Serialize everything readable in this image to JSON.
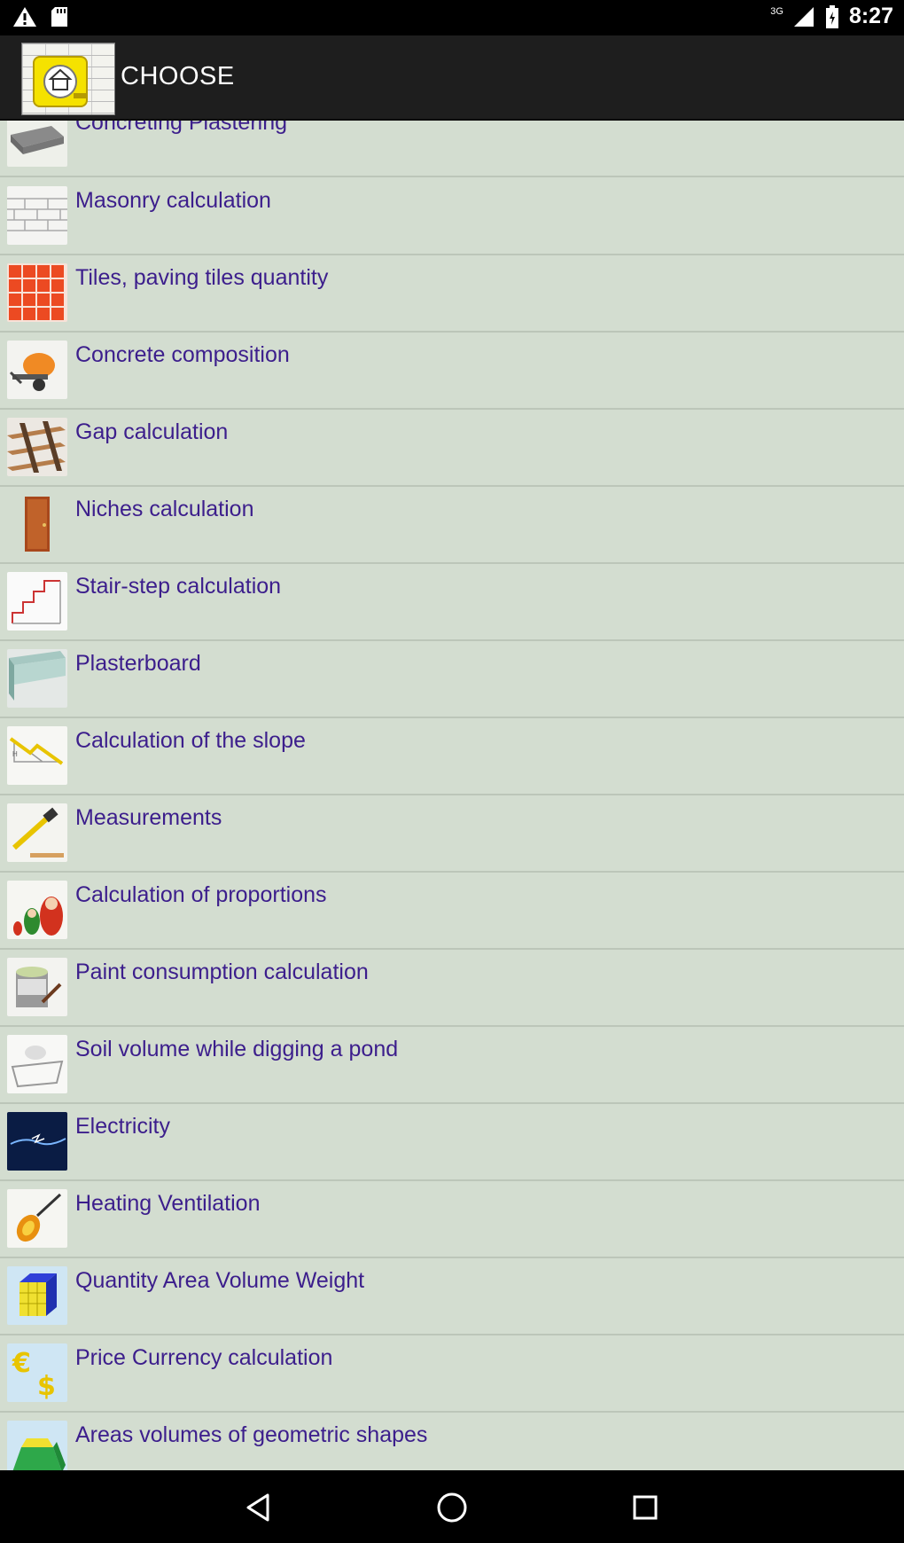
{
  "status_bar": {
    "time": "8:27",
    "network": "3G",
    "left_icons": [
      "warning-icon",
      "sd-card-icon"
    ],
    "right_icons": [
      "signal-icon",
      "battery-icon"
    ]
  },
  "app_bar": {
    "title": "CHOOSE",
    "logo_icon": "house-tape-measure-icon"
  },
  "list": {
    "items": [
      {
        "label": "Concreting Plastering",
        "icon": "concrete-slab-icon"
      },
      {
        "label": "Masonry calculation",
        "icon": "brick-wall-icon"
      },
      {
        "label": "Tiles, paving tiles quantity",
        "icon": "tiles-icon"
      },
      {
        "label": "Concrete composition",
        "icon": "concrete-mixer-icon"
      },
      {
        "label": "Gap calculation",
        "icon": "wood-frame-icon"
      },
      {
        "label": "Niches calculation",
        "icon": "door-icon"
      },
      {
        "label": "Stair-step calculation",
        "icon": "stairs-diagram-icon"
      },
      {
        "label": "Plasterboard",
        "icon": "plasterboard-icon"
      },
      {
        "label": "Calculation of the slope",
        "icon": "slope-icon"
      },
      {
        "label": "Measurements",
        "icon": "measuring-tool-icon"
      },
      {
        "label": "Calculation of proportions",
        "icon": "nesting-dolls-icon"
      },
      {
        "label": "Paint consumption calculation",
        "icon": "paint-bucket-icon"
      },
      {
        "label": "Soil volume while digging a pond",
        "icon": "pond-icon"
      },
      {
        "label": "Electricity",
        "icon": "electricity-icon"
      },
      {
        "label": "Heating Ventilation",
        "icon": "flame-icon"
      },
      {
        "label": "Quantity Area Volume Weight",
        "icon": "cube-icon"
      },
      {
        "label": "Price Currency calculation",
        "icon": "currency-icon"
      },
      {
        "label": "Areas volumes of geometric shapes",
        "icon": "geometric-shapes-icon"
      }
    ]
  },
  "nav_bar": {
    "buttons": [
      "back-icon",
      "home-icon",
      "recents-icon"
    ]
  },
  "colors": {
    "list_background": "#d3ddd0",
    "label_text": "#3c1e8c",
    "app_bar": "#1e1e1e",
    "divider": "#bcc6b9"
  }
}
